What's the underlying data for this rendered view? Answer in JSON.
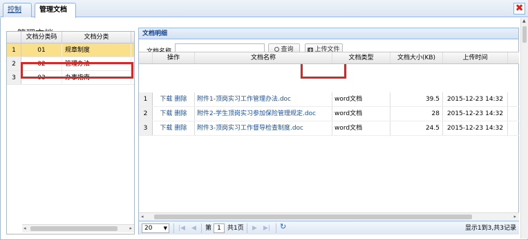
{
  "tabs": [
    {
      "label": "控制台"
    },
    {
      "label": "管理文档",
      "close": "×"
    }
  ],
  "window_close": "✖",
  "page_title": "管理文档",
  "left_grid": {
    "columns": [
      "文档分类码",
      "文档分类"
    ],
    "rows": [
      {
        "num": "1",
        "code": "01",
        "name": "规章制度"
      },
      {
        "num": "2",
        "code": "02",
        "name": "管理办法"
      },
      {
        "num": "3",
        "code": "03",
        "name": "办事指南"
      }
    ]
  },
  "right_panel": {
    "title": "文档明细",
    "search_label": "文档名称",
    "search_value": "",
    "query_button": "查询",
    "upload_button": "上传文件",
    "columns": [
      "操作",
      "文档名称",
      "文档类型",
      "文档大小(KB)",
      "上传时间"
    ],
    "rows": [
      {
        "num": "1",
        "download": "下载",
        "delete": "删除",
        "name": "附件1-顶岗实习工作管理办法.doc",
        "type": "word文档",
        "size": "39.5",
        "time": "2015-12-23 14:32"
      },
      {
        "num": "2",
        "download": "下载",
        "delete": "删除",
        "name": "附件2-学生顶岗实习参加保险管理规定.doc",
        "type": "word文档",
        "size": "28",
        "time": "2015-12-23 14:32"
      },
      {
        "num": "3",
        "download": "下载",
        "delete": "删除",
        "name": "附件3-顶岗实习工作督导检查制度.doc",
        "type": "word文档",
        "size": "24.5",
        "time": "2015-12-23 14:32"
      }
    ]
  },
  "pager": {
    "page_size": "20",
    "page_prefix": "第",
    "page_value": "1",
    "page_suffix": "共1页",
    "info": "显示1到3,共3记录"
  },
  "colors": {
    "highlight": "#e02424",
    "selected_row": "#fbe08c",
    "link": "#1c4f9c"
  }
}
